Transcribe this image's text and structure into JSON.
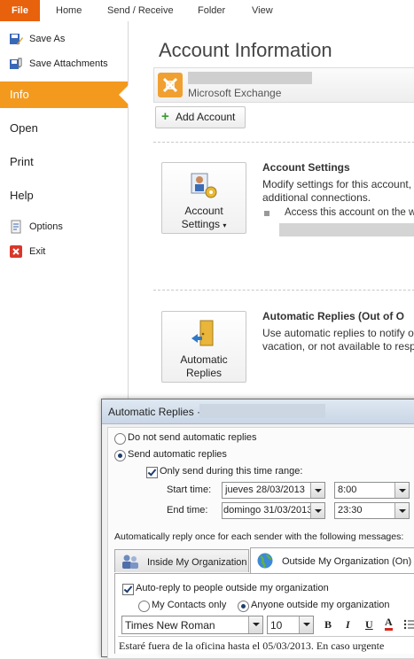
{
  "ribbon": {
    "file": "File",
    "tabs": [
      "Home",
      "Send / Receive",
      "Folder",
      "View"
    ]
  },
  "nav": {
    "save_as": "Save As",
    "save_attachments": "Save Attachments",
    "info": "Info",
    "open": "Open",
    "print": "Print",
    "help": "Help",
    "options": "Options",
    "exit": "Exit"
  },
  "main": {
    "title": "Account Information",
    "account_type": "Microsoft Exchange",
    "add_account": "Add Account",
    "account_settings_btn_line1": "Account",
    "account_settings_btn_line2": "Settings",
    "account_settings_title": "Account Settings",
    "account_settings_desc1": "Modify settings for this account,",
    "account_settings_desc2": "additional connections.",
    "account_settings_bullet": "Access this account on the w",
    "auto_replies_btn_line1": "Automatic",
    "auto_replies_btn_line2": "Replies",
    "auto_replies_title": "Automatic Replies (Out of O",
    "auto_replies_desc1": "Use automatic replies to notify o",
    "auto_replies_desc2": "vacation, or not available to resp"
  },
  "dialog": {
    "title": "Automatic Replies ·",
    "no_auto": "Do not send automatic replies",
    "send_auto": "Send automatic replies",
    "only_range": "Only send during this time range:",
    "start_label": "Start time:",
    "start_date": "jueves 28/03/2013",
    "start_time": "8:00",
    "end_label": "End time:",
    "end_date": "domingo 31/03/2013",
    "end_time": "23:30",
    "reply_once": "Automatically reply once for each sender with the following messages:",
    "tab_inside": "Inside My Organization",
    "tab_outside": "Outside My Organization (On)",
    "auto_reply_outside": "Auto-reply to people outside my organization",
    "my_contacts": "My Contacts only",
    "anyone_outside": "Anyone outside my organization",
    "font_name": "Times New Roman",
    "font_size": "10",
    "bold": "B",
    "italic": "I",
    "underline": "U",
    "font_color": "A",
    "body_text": "Estaré fuera de la oficina hasta el 05/03/2013. En caso urgente"
  },
  "colors": {
    "file_tab": "#e8610c",
    "info_selected": "#f39a1e",
    "exchange_icon": "#f0a030"
  }
}
